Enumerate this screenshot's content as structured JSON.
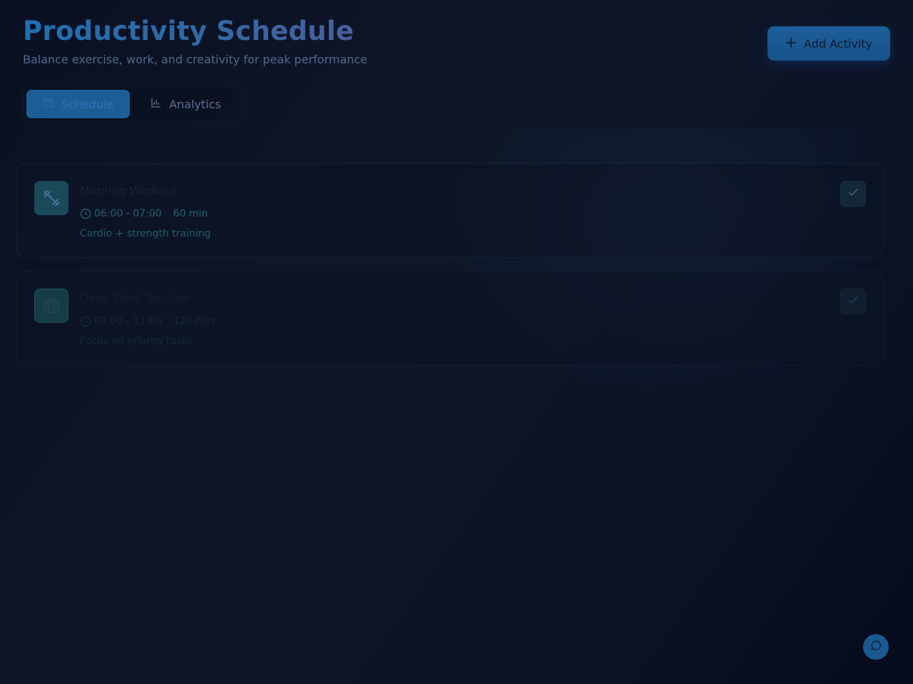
{
  "header": {
    "title": "Productivity Schedule",
    "subtitle": "Balance exercise, work, and creativity for peak performance"
  },
  "actions": {
    "add_label": "Add Activity",
    "add_icon": "plus-icon"
  },
  "tabs": [
    {
      "label": "Schedule",
      "icon": "calendar-icon",
      "active": true
    },
    {
      "label": "Analytics",
      "icon": "bar-chart-icon",
      "active": false
    }
  ],
  "activities": [
    {
      "name": "Morning Workout",
      "icon": "dumbbell-icon",
      "time": "06:00 - 07:00",
      "duration": "60 min",
      "description": "Cardio + strength training",
      "completed": false
    },
    {
      "name": "Deep Work Session",
      "icon": "briefcase-icon",
      "time": "09:00 - 11:00",
      "duration": "120 min",
      "description": "Focus on priority tasks",
      "completed": false
    }
  ],
  "chat": {
    "icon": "chat-bubble-icon"
  },
  "colors": {
    "accent": "#1b5e96",
    "background": "#0d1629",
    "title_gradient_start": "#1f6fb0",
    "title_gradient_end": "#4a5f9c"
  }
}
